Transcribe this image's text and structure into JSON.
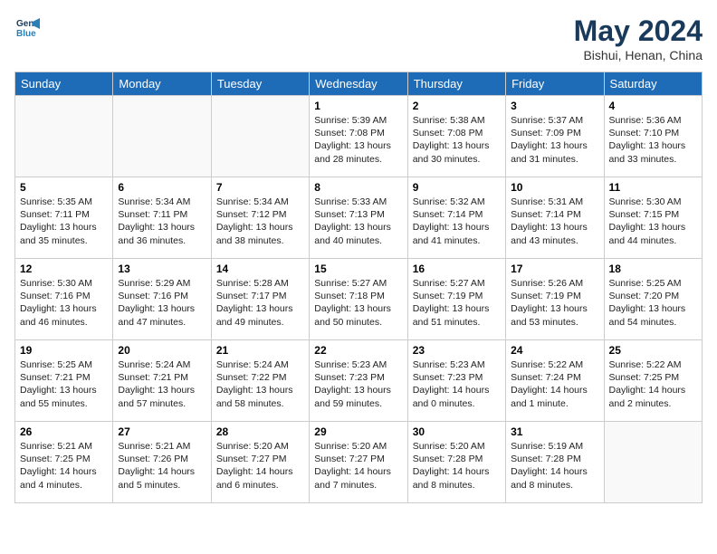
{
  "header": {
    "logo_line1": "General",
    "logo_line2": "Blue",
    "title": "May 2024",
    "subtitle": "Bishui, Henan, China"
  },
  "days_of_week": [
    "Sunday",
    "Monday",
    "Tuesday",
    "Wednesday",
    "Thursday",
    "Friday",
    "Saturday"
  ],
  "weeks": [
    [
      {
        "day": "",
        "info": ""
      },
      {
        "day": "",
        "info": ""
      },
      {
        "day": "",
        "info": ""
      },
      {
        "day": "1",
        "info": "Sunrise: 5:39 AM\nSunset: 7:08 PM\nDaylight: 13 hours and 28 minutes."
      },
      {
        "day": "2",
        "info": "Sunrise: 5:38 AM\nSunset: 7:08 PM\nDaylight: 13 hours and 30 minutes."
      },
      {
        "day": "3",
        "info": "Sunrise: 5:37 AM\nSunset: 7:09 PM\nDaylight: 13 hours and 31 minutes."
      },
      {
        "day": "4",
        "info": "Sunrise: 5:36 AM\nSunset: 7:10 PM\nDaylight: 13 hours and 33 minutes."
      }
    ],
    [
      {
        "day": "5",
        "info": "Sunrise: 5:35 AM\nSunset: 7:11 PM\nDaylight: 13 hours and 35 minutes."
      },
      {
        "day": "6",
        "info": "Sunrise: 5:34 AM\nSunset: 7:11 PM\nDaylight: 13 hours and 36 minutes."
      },
      {
        "day": "7",
        "info": "Sunrise: 5:34 AM\nSunset: 7:12 PM\nDaylight: 13 hours and 38 minutes."
      },
      {
        "day": "8",
        "info": "Sunrise: 5:33 AM\nSunset: 7:13 PM\nDaylight: 13 hours and 40 minutes."
      },
      {
        "day": "9",
        "info": "Sunrise: 5:32 AM\nSunset: 7:14 PM\nDaylight: 13 hours and 41 minutes."
      },
      {
        "day": "10",
        "info": "Sunrise: 5:31 AM\nSunset: 7:14 PM\nDaylight: 13 hours and 43 minutes."
      },
      {
        "day": "11",
        "info": "Sunrise: 5:30 AM\nSunset: 7:15 PM\nDaylight: 13 hours and 44 minutes."
      }
    ],
    [
      {
        "day": "12",
        "info": "Sunrise: 5:30 AM\nSunset: 7:16 PM\nDaylight: 13 hours and 46 minutes."
      },
      {
        "day": "13",
        "info": "Sunrise: 5:29 AM\nSunset: 7:16 PM\nDaylight: 13 hours and 47 minutes."
      },
      {
        "day": "14",
        "info": "Sunrise: 5:28 AM\nSunset: 7:17 PM\nDaylight: 13 hours and 49 minutes."
      },
      {
        "day": "15",
        "info": "Sunrise: 5:27 AM\nSunset: 7:18 PM\nDaylight: 13 hours and 50 minutes."
      },
      {
        "day": "16",
        "info": "Sunrise: 5:27 AM\nSunset: 7:19 PM\nDaylight: 13 hours and 51 minutes."
      },
      {
        "day": "17",
        "info": "Sunrise: 5:26 AM\nSunset: 7:19 PM\nDaylight: 13 hours and 53 minutes."
      },
      {
        "day": "18",
        "info": "Sunrise: 5:25 AM\nSunset: 7:20 PM\nDaylight: 13 hours and 54 minutes."
      }
    ],
    [
      {
        "day": "19",
        "info": "Sunrise: 5:25 AM\nSunset: 7:21 PM\nDaylight: 13 hours and 55 minutes."
      },
      {
        "day": "20",
        "info": "Sunrise: 5:24 AM\nSunset: 7:21 PM\nDaylight: 13 hours and 57 minutes."
      },
      {
        "day": "21",
        "info": "Sunrise: 5:24 AM\nSunset: 7:22 PM\nDaylight: 13 hours and 58 minutes."
      },
      {
        "day": "22",
        "info": "Sunrise: 5:23 AM\nSunset: 7:23 PM\nDaylight: 13 hours and 59 minutes."
      },
      {
        "day": "23",
        "info": "Sunrise: 5:23 AM\nSunset: 7:23 PM\nDaylight: 14 hours and 0 minutes."
      },
      {
        "day": "24",
        "info": "Sunrise: 5:22 AM\nSunset: 7:24 PM\nDaylight: 14 hours and 1 minute."
      },
      {
        "day": "25",
        "info": "Sunrise: 5:22 AM\nSunset: 7:25 PM\nDaylight: 14 hours and 2 minutes."
      }
    ],
    [
      {
        "day": "26",
        "info": "Sunrise: 5:21 AM\nSunset: 7:25 PM\nDaylight: 14 hours and 4 minutes."
      },
      {
        "day": "27",
        "info": "Sunrise: 5:21 AM\nSunset: 7:26 PM\nDaylight: 14 hours and 5 minutes."
      },
      {
        "day": "28",
        "info": "Sunrise: 5:20 AM\nSunset: 7:27 PM\nDaylight: 14 hours and 6 minutes."
      },
      {
        "day": "29",
        "info": "Sunrise: 5:20 AM\nSunset: 7:27 PM\nDaylight: 14 hours and 7 minutes."
      },
      {
        "day": "30",
        "info": "Sunrise: 5:20 AM\nSunset: 7:28 PM\nDaylight: 14 hours and 8 minutes."
      },
      {
        "day": "31",
        "info": "Sunrise: 5:19 AM\nSunset: 7:28 PM\nDaylight: 14 hours and 8 minutes."
      },
      {
        "day": "",
        "info": ""
      }
    ]
  ]
}
